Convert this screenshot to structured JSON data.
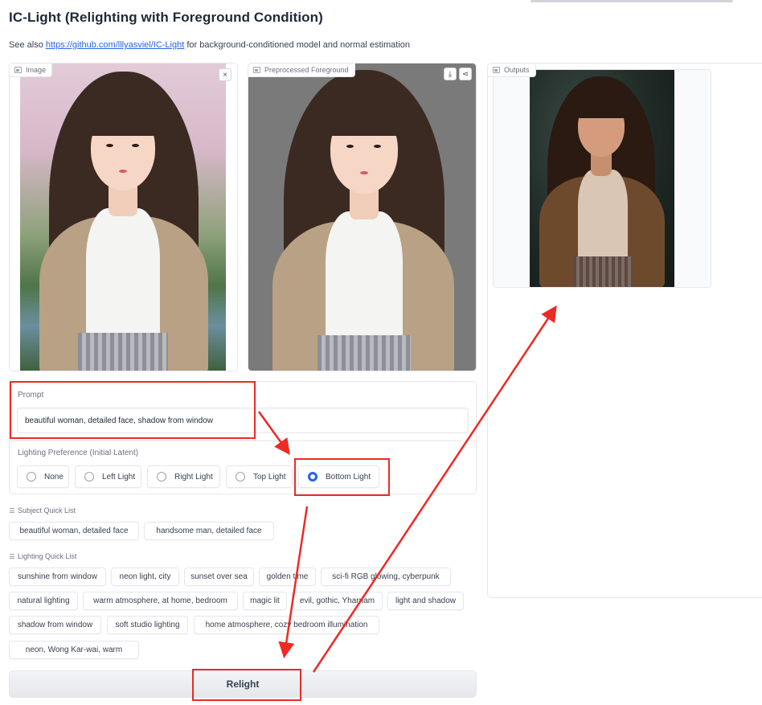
{
  "app": {
    "title": "IC-Light (Relighting with Foreground Condition)",
    "see_also_prefix": "See also ",
    "see_also_link": "https://github.com/lllyasviel/IC-Light",
    "see_also_suffix": " for background-conditioned model and normal estimation"
  },
  "panels": {
    "image": {
      "label": "Image",
      "close_icon": "×"
    },
    "foreground": {
      "label": "Preprocessed Foreground",
      "download_icon": "⤓",
      "share_icon": "⋖"
    },
    "outputs": {
      "label": "Outputs"
    }
  },
  "prompt": {
    "label": "Prompt",
    "value": "beautiful woman, detailed face, shadow from window"
  },
  "lighting_preference": {
    "label": "Lighting Preference (Initial Latent)",
    "options": [
      "None",
      "Left Light",
      "Right Light",
      "Top Light",
      "Bottom Light"
    ],
    "selected": "Bottom Light"
  },
  "subject_quick_list": {
    "label": "Subject Quick List",
    "items": [
      "beautiful woman, detailed face",
      "handsome man, detailed face"
    ]
  },
  "lighting_quick_list": {
    "label": "Lighting Quick List",
    "items": [
      "sunshine from window",
      "neon light, city",
      "sunset over sea",
      "golden time",
      "sci-fi RGB glowing, cyberpunk",
      "natural lighting",
      "warm atmosphere, at home, bedroom",
      "magic lit",
      "evil, gothic, Yharnam",
      "light and shadow",
      "shadow from window",
      "soft studio lighting",
      "home atmosphere, cozy bedroom illumination",
      "neon, Wong Kar-wai, warm"
    ]
  },
  "actions": {
    "relight_label": "Relight"
  },
  "colors": {
    "accent": "#2563eb",
    "annotation_red": "#ec2b24",
    "border": "#e5e7eb"
  }
}
